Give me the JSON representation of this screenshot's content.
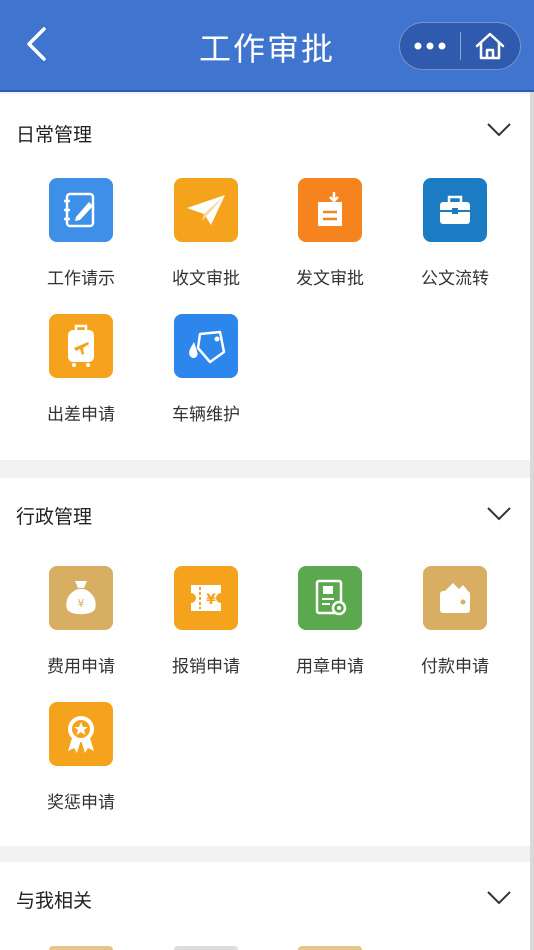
{
  "header": {
    "title": "工作审批",
    "background": "#3f74cf"
  },
  "sections": [
    {
      "title": "日常管理",
      "items": [
        {
          "label": "工作请示",
          "color": "#3d8fe8",
          "icon": "notebook-pen-icon"
        },
        {
          "label": "收文审批",
          "color": "#f5a31c",
          "icon": "paper-plane-icon"
        },
        {
          "label": "发文审批",
          "color": "#f5841f",
          "icon": "document-download-icon"
        },
        {
          "label": "公文流转",
          "color": "#1b7bc3",
          "icon": "briefcase-icon"
        },
        {
          "label": "出差申请",
          "color": "#f5a31c",
          "icon": "luggage-plane-icon"
        },
        {
          "label": "车辆维护",
          "color": "#2d86ec",
          "icon": "tag-drop-icon"
        }
      ]
    },
    {
      "title": "行政管理",
      "items": [
        {
          "label": "费用申请",
          "color": "#d7ae62",
          "icon": "money-bag-icon"
        },
        {
          "label": "报销申请",
          "color": "#f5a31c",
          "icon": "receipt-yen-icon"
        },
        {
          "label": "用章申请",
          "color": "#5ba84e",
          "icon": "stamp-certificate-icon"
        },
        {
          "label": "付款申请",
          "color": "#d7ae62",
          "icon": "wallet-icon"
        },
        {
          "label": "奖惩申请",
          "color": "#f5a31c",
          "icon": "award-ribbon-icon"
        }
      ]
    },
    {
      "title": "与我相关",
      "items": []
    }
  ]
}
